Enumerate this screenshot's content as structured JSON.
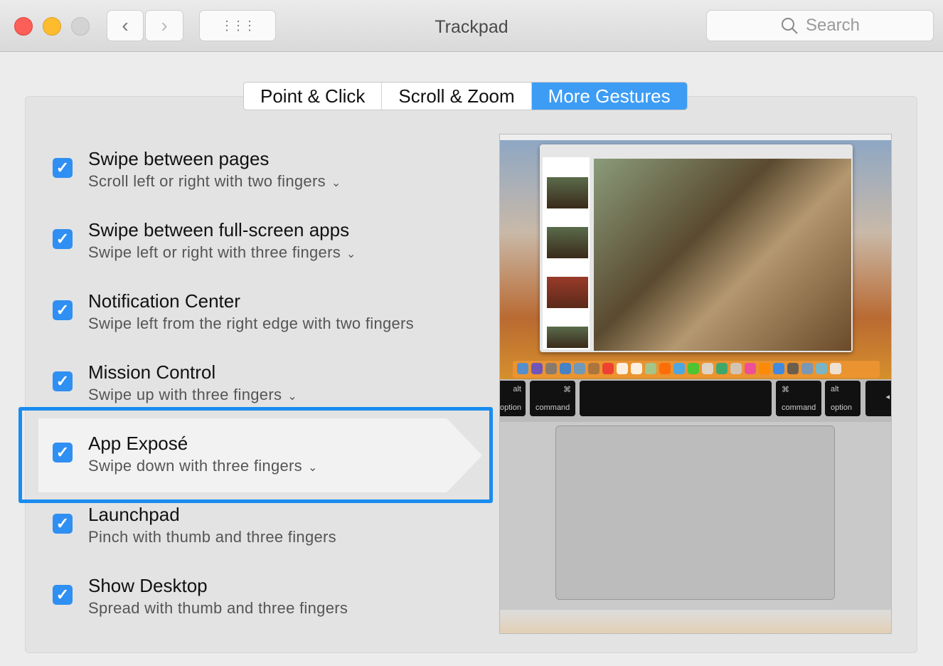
{
  "window": {
    "title": "Trackpad",
    "search_placeholder": "Search"
  },
  "toolbar": {
    "back": "‹",
    "forward": "›",
    "grid": "⋮⋮⋮"
  },
  "tabs": [
    {
      "label": "Point & Click"
    },
    {
      "label": "Scroll & Zoom"
    },
    {
      "label": "More Gestures",
      "active": true
    }
  ],
  "items": [
    {
      "title": "Swipe between pages",
      "subtitle": "Scroll left or right with two fingers",
      "dropdown": true,
      "checked": true
    },
    {
      "title": "Swipe between full-screen apps",
      "subtitle": "Swipe left or right with three fingers",
      "dropdown": true,
      "checked": true
    },
    {
      "title": "Notification Center",
      "subtitle": "Swipe left from the right edge with two fingers",
      "dropdown": false,
      "checked": true
    },
    {
      "title": "Mission Control",
      "subtitle": "Swipe up with three fingers",
      "dropdown": true,
      "checked": true
    },
    {
      "title": "App Exposé",
      "subtitle": "Swipe down with three fingers",
      "dropdown": true,
      "checked": true,
      "highlighted": true
    },
    {
      "title": "Launchpad",
      "subtitle": "Pinch with thumb and three fingers",
      "dropdown": false,
      "checked": true
    },
    {
      "title": "Show Desktop",
      "subtitle": "Spread with thumb and three fingers",
      "dropdown": false,
      "checked": true
    }
  ],
  "preview": {
    "keys": [
      {
        "top": "alt",
        "bottom": "option"
      },
      {
        "top": "⌘",
        "bottom": "command"
      },
      {
        "top": "⌘",
        "bottom": "command"
      },
      {
        "top": "alt",
        "bottom": "option"
      }
    ],
    "arrow": "◂"
  },
  "colors": {
    "accent": "#3d9cf4",
    "highlight": "#1a8cf0"
  }
}
